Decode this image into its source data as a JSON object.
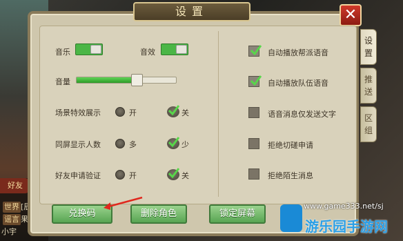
{
  "background": {
    "friend_label": "好友",
    "chat": [
      {
        "tag": "世界",
        "text": "[辰"
      },
      {
        "tag": "谣言",
        "text": "果然"
      },
      {
        "tag": "",
        "text": "小宇"
      }
    ]
  },
  "dialog": {
    "title": "设置",
    "close_label": "✕",
    "tabs": [
      {
        "label": "设置",
        "active": true
      },
      {
        "label": "推送",
        "active": false
      },
      {
        "label": "区组",
        "active": false
      }
    ]
  },
  "left_settings": {
    "music_label": "音乐",
    "music_on": true,
    "sfx_label": "音效",
    "sfx_on": true,
    "volume_label": "音量",
    "volume_value": 0.6,
    "scene_effects": {
      "label": "场景特效展示",
      "option_a": "开",
      "option_b": "关",
      "selected": "关"
    },
    "same_screen": {
      "label": "同屏显示人数",
      "option_a": "多",
      "option_b": "少",
      "selected": "少"
    },
    "friend_verify": {
      "label": "好友申请验证",
      "option_a": "开",
      "option_b": "关",
      "selected": "关"
    }
  },
  "right_settings": [
    {
      "label": "自动播放帮派语音",
      "checked": true
    },
    {
      "label": "自动播放队伍语音",
      "checked": true
    },
    {
      "label": "语音消息仅发送文字",
      "checked": false
    },
    {
      "label": "拒绝切磋申请",
      "checked": false
    },
    {
      "label": "拒绝陌生消息",
      "checked": false
    }
  ],
  "buttons": {
    "redeem": "兑换码",
    "delete_role": "删除角色",
    "lock_screen": "锁定屏幕"
  },
  "watermark": {
    "url": "www.game333.net/sj",
    "name": "游乐园手游网"
  },
  "colors": {
    "toggle_on": "#4bb646",
    "button_green": "#58a553",
    "close_red": "#c0392b"
  }
}
